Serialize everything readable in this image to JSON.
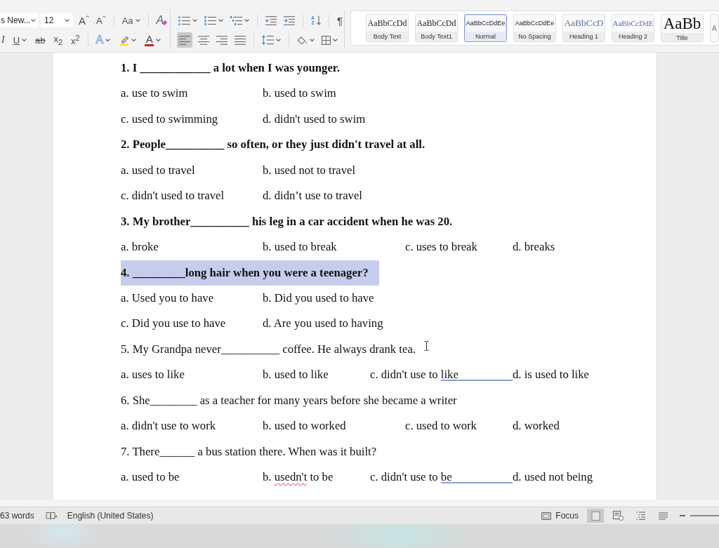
{
  "ribbon": {
    "sections": [
      {
        "rows": [
          [
            [
              {
                "kind": "font_field",
                "value": "s New...",
                "dropdown": true
              },
              {
                "kind": "size_field",
                "value": "12",
                "dropdown": true
              },
              {
                "kind": "grow",
                "label": "A"
              },
              {
                "kind": "shrink",
                "label": "A"
              }
            ],
            [
              {
                "kind": "case",
                "label": "Aa",
                "dropdown": true
              }
            ],
            [
              {
                "kind": "clear",
                "label": "A"
              }
            ]
          ],
          [
            [
              {
                "kind": "italic",
                "label": "I"
              },
              {
                "kind": "underline",
                "label": "U",
                "dropdown": true
              },
              {
                "kind": "strike",
                "label": "ab"
              },
              {
                "kind": "subscript",
                "label": "x$_{2}$"
              },
              {
                "kind": "superscript",
                "label": "x$^{2}$"
              }
            ],
            [
              {
                "kind": "effects",
                "label": "A",
                "dropdown": true
              },
              {
                "kind": "highlight",
                "dropdown": true
              },
              {
                "kind": "font_color",
                "label": "A",
                "dropdown": true
              }
            ]
          ]
        ]
      },
      {
        "rows": [
          [
            [
              {
                "kind": "bullets",
                "dropdown": true
              },
              {
                "kind": "numbering",
                "dropdown": true
              },
              {
                "kind": "multilevel",
                "dropdown": true
              }
            ],
            [
              {
                "kind": "outdent"
              },
              {
                "kind": "indent"
              }
            ],
            [
              {
                "kind": "sort",
                "lines": [
                  "A",
                  "Z"
                ]
              }
            ],
            [
              {
                "kind": "pilcrow",
                "label": "¶"
              }
            ]
          ],
          [
            [
              {
                "kind": "align_left",
                "selected": true
              },
              {
                "kind": "align_center",
                "selected": false
              },
              {
                "kind": "align_right",
                "selected": false
              },
              {
                "kind": "justify",
                "selected": false
              }
            ],
            [
              {
                "kind": "line_spacing",
                "dropdown": true
              }
            ],
            [
              {
                "kind": "shading",
                "dropdown": true
              },
              {
                "kind": "borders",
                "dropdown": true
              }
            ]
          ]
        ]
      }
    ]
  },
  "styles_gallery": [
    {
      "preview": "AaBbCcDd",
      "label": "Body Text",
      "kind": "body",
      "selected": false
    },
    {
      "preview": "AaBbCcDd",
      "label": "Body Text1",
      "kind": "body",
      "selected": false
    },
    {
      "preview": "AaBbCcDdEe",
      "label": "Normal",
      "kind": "normal",
      "selected": true
    },
    {
      "preview": "AaBbCcDdEe",
      "label": "No Spacing",
      "kind": "normal",
      "selected": false
    },
    {
      "preview": "AaBbCcD",
      "label": "Heading 1",
      "kind": "heading1",
      "selected": false
    },
    {
      "preview": "AaBbCcDdE",
      "label": "Heading 2",
      "kind": "heading2",
      "selected": false
    },
    {
      "preview": "AaBb",
      "label": "Title",
      "kind": "title",
      "selected": false
    },
    {
      "preview": "A",
      "kind": "subtle",
      "selected": false
    }
  ],
  "document": {
    "questions": [
      {
        "text": "1. I ____________ a lot when I was younger.",
        "bold": true,
        "selected": false,
        "option_rows": [
          [
            {
              "text": "a. use to swim"
            },
            {
              "text": "b. used to swim"
            }
          ],
          [
            {
              "text": "c. used to swimming"
            },
            {
              "text": "d. didn't used to swim"
            }
          ]
        ]
      },
      {
        "text": "2. People__________ so often, or they just didn't travel at all.",
        "bold": true,
        "selected": false,
        "option_rows": [
          [
            {
              "text": "a. used to travel"
            },
            {
              "text": "b. used not to travel"
            }
          ],
          [
            {
              "text": "c. didn't used to travel"
            },
            {
              "text": "d. didn’t use to travel"
            }
          ]
        ]
      },
      {
        "text": "3. My brother__________ his leg in a car accident when he was 20.",
        "bold": true,
        "selected": false,
        "option_rows": [
          [
            {
              "text": "a. broke"
            },
            {
              "text": "b. used to break"
            },
            {
              "text": "c. uses to break"
            },
            {
              "text": "d. breaks"
            }
          ]
        ]
      },
      {
        "text": "4. _________long hair when you were a teenager?",
        "bold": true,
        "selected": true,
        "option_rows": [
          [
            {
              "text": "a. Used you to have"
            },
            {
              "text": "b. Did you used to have"
            }
          ],
          [
            {
              "text": "c. Did you use to have"
            },
            {
              "text": "d. Are you used to having"
            }
          ]
        ]
      },
      {
        "text": "5. My Grandpa never__________ coffee. He always drank tea.",
        "bold": false,
        "selected": false,
        "option_rows": [
          [
            {
              "text": "a. uses to like"
            },
            {
              "text": "b. used to like"
            },
            {
              "segments": [
                {
                  "text": "c. didn't use to "
                },
                {
                  "text": "like",
                  "grammar_error": true
                }
              ],
              "tab_grammar_error": true
            },
            {
              "text": "d. is used to like"
            }
          ]
        ]
      },
      {
        "text": "6. She________ as a teacher for many years before she became a writer",
        "bold": false,
        "selected": false,
        "option_rows": [
          [
            {
              "text": "a. didn't use to work"
            },
            {
              "text": "b. used to worked"
            },
            {
              "text": "c. used to work"
            },
            {
              "text": "d. worked"
            }
          ]
        ]
      },
      {
        "text": "7. There______ a bus station there. When was it built?",
        "bold": false,
        "selected": false,
        "option_rows": [
          [
            {
              "text": "a. used to be"
            },
            {
              "segments": [
                {
                  "text": "b. "
                },
                {
                  "text": "usedn't",
                  "spelling_error": true
                },
                {
                  "text": " to be"
                }
              ]
            },
            {
              "segments": [
                {
                  "text": "c. didn't use to "
                },
                {
                  "text": "be",
                  "grammar_error": true
                }
              ],
              "tab_grammar_error": true
            },
            {
              "text": "d. used not being"
            }
          ]
        ]
      }
    ]
  },
  "status_bar": {
    "word_count": "63 words",
    "language": "English (United States)",
    "focus": "Focus",
    "views": [
      {
        "kind": "print",
        "selected": true
      },
      {
        "kind": "web",
        "selected": false
      },
      {
        "kind": "outline",
        "selected": false
      },
      {
        "kind": "draft",
        "selected": false
      }
    ]
  }
}
